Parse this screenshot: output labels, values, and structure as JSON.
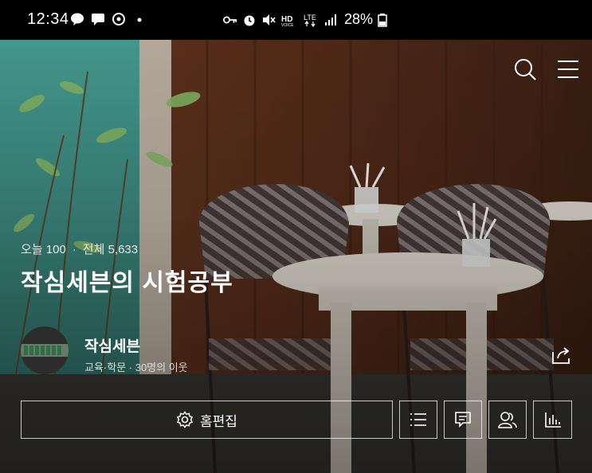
{
  "status_bar": {
    "time": "12:34",
    "left_icons": [
      "talk-icon",
      "message-icon",
      "sync-icon",
      "dot-icon"
    ],
    "right_icons": [
      "key-icon",
      "alarm-icon",
      "mute-icon",
      "hd-voice-icon",
      "lte-icon",
      "signal-icon"
    ],
    "battery": "28%"
  },
  "header": {
    "icons": [
      "search-icon",
      "menu-icon"
    ]
  },
  "blog": {
    "today_label": "오늘 100",
    "total_label": "전체 5,633",
    "title": "작심세븐의 시험공부"
  },
  "profile": {
    "nickname": "작심세븐",
    "meta": "교육·학문 · 30명의 이웃"
  },
  "actions": {
    "home_edit_label": "홈편집",
    "icons": [
      "list-icon",
      "comment-icon",
      "neighbor-icon",
      "stats-icon",
      "share-icon"
    ]
  },
  "colors": {
    "status_bg": "#000000",
    "text": "#ffffff",
    "wall": "#5a2f1c",
    "teal": "#3e8f86"
  }
}
